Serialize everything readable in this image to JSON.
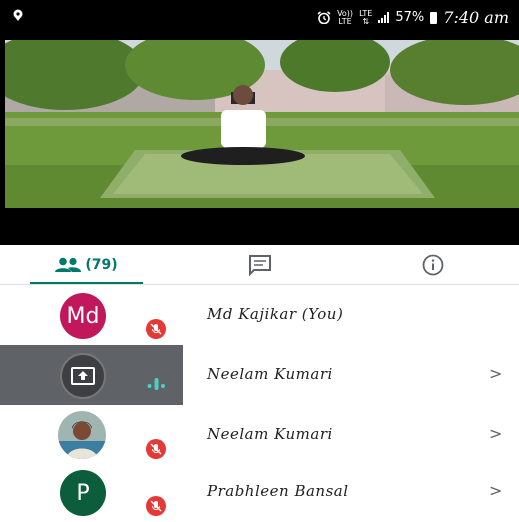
{
  "status_bar": {
    "volte_top": "Vo))",
    "volte_bottom": "LTE",
    "lte_top": "LTE",
    "battery": "57%",
    "time": "7:40 am"
  },
  "tabs": {
    "people_count": "(79)",
    "accent_color": "#00796b"
  },
  "participants": [
    {
      "initials": "Md",
      "name": "Md Kajikar (You)",
      "avatar_color": "#c2185b",
      "muted": true,
      "chevron": ""
    },
    {
      "initials": "",
      "name": "Neelam Kumari",
      "presenting": true,
      "speaking": true,
      "chevron": ">"
    },
    {
      "initials": "",
      "name": "Neelam Kumari",
      "photo": true,
      "muted": true,
      "chevron": ">"
    },
    {
      "initials": "P",
      "name": "Prabhleen Bansal",
      "avatar_color": "#0b5d3b",
      "muted": true,
      "chevron": ">"
    }
  ]
}
